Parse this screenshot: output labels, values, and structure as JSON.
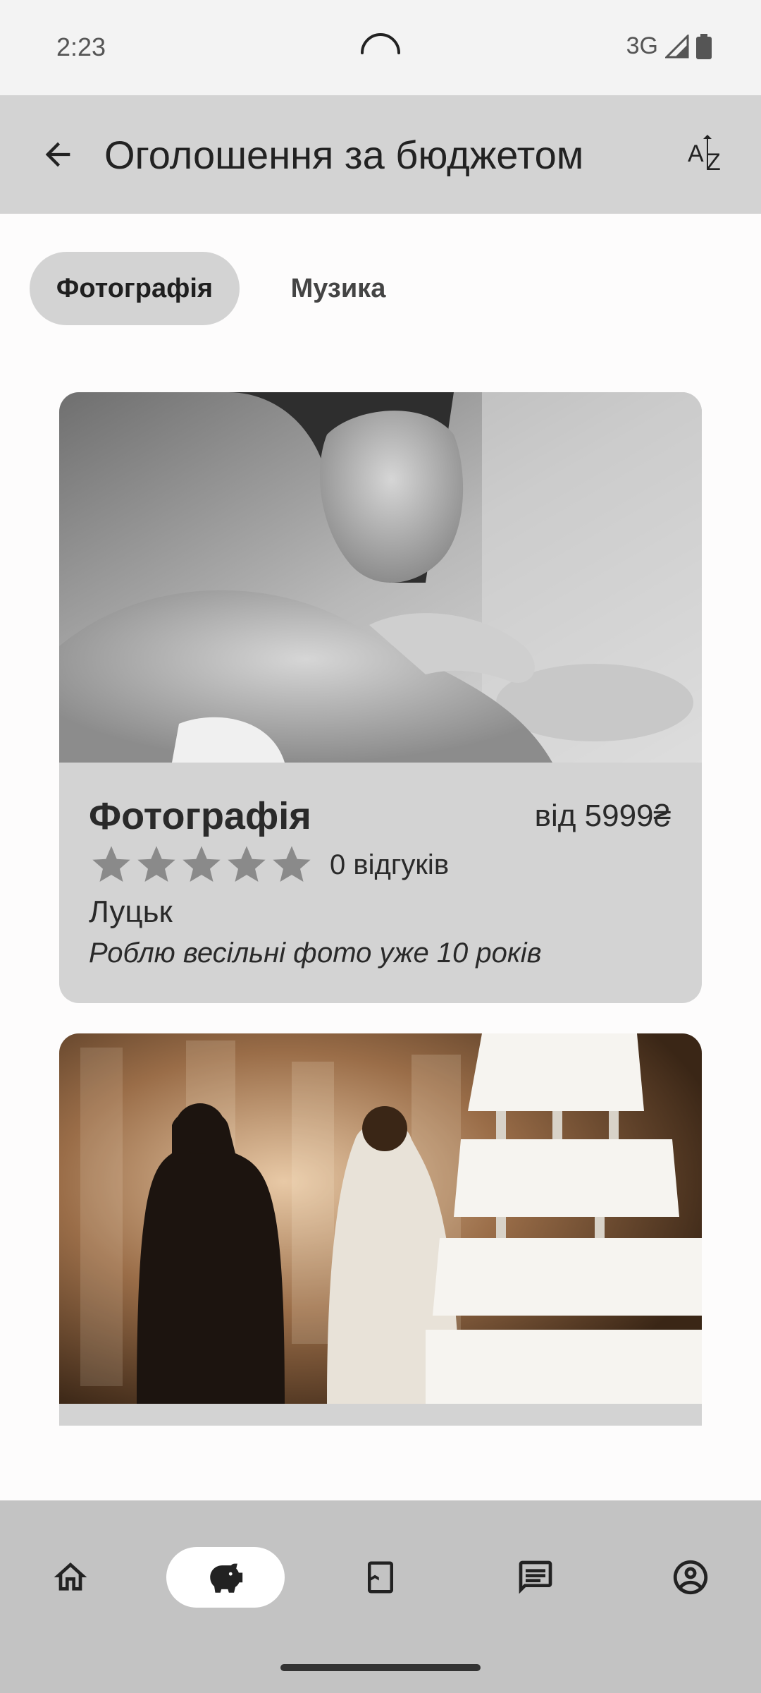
{
  "status_bar": {
    "time": "2:23",
    "network": "3G"
  },
  "app_bar": {
    "title": "Оголошення за бюджетом",
    "back_icon": "arrow-back-icon",
    "sort_icon": "sort-az-icon"
  },
  "chips": [
    {
      "label": "Фотографія",
      "selected": true
    },
    {
      "label": "Музика",
      "selected": false
    }
  ],
  "cards": [
    {
      "title": "Фотографія",
      "price": "від 5999₴",
      "rating": 0,
      "reviews": "0 відгуків",
      "city": "Луцьк",
      "description": "Роблю весільні фото уже 10 років"
    }
  ],
  "bottom_nav": {
    "items": [
      "home-icon",
      "piggy-bank-icon",
      "bookmark-icon",
      "chat-icon",
      "account-icon"
    ],
    "active_index": 1
  },
  "colors": {
    "app_bar": "#d3d3d3",
    "card": "#d3d3d3",
    "bottom_nav": "#c3c3c3",
    "star": "#8a8a8a"
  }
}
